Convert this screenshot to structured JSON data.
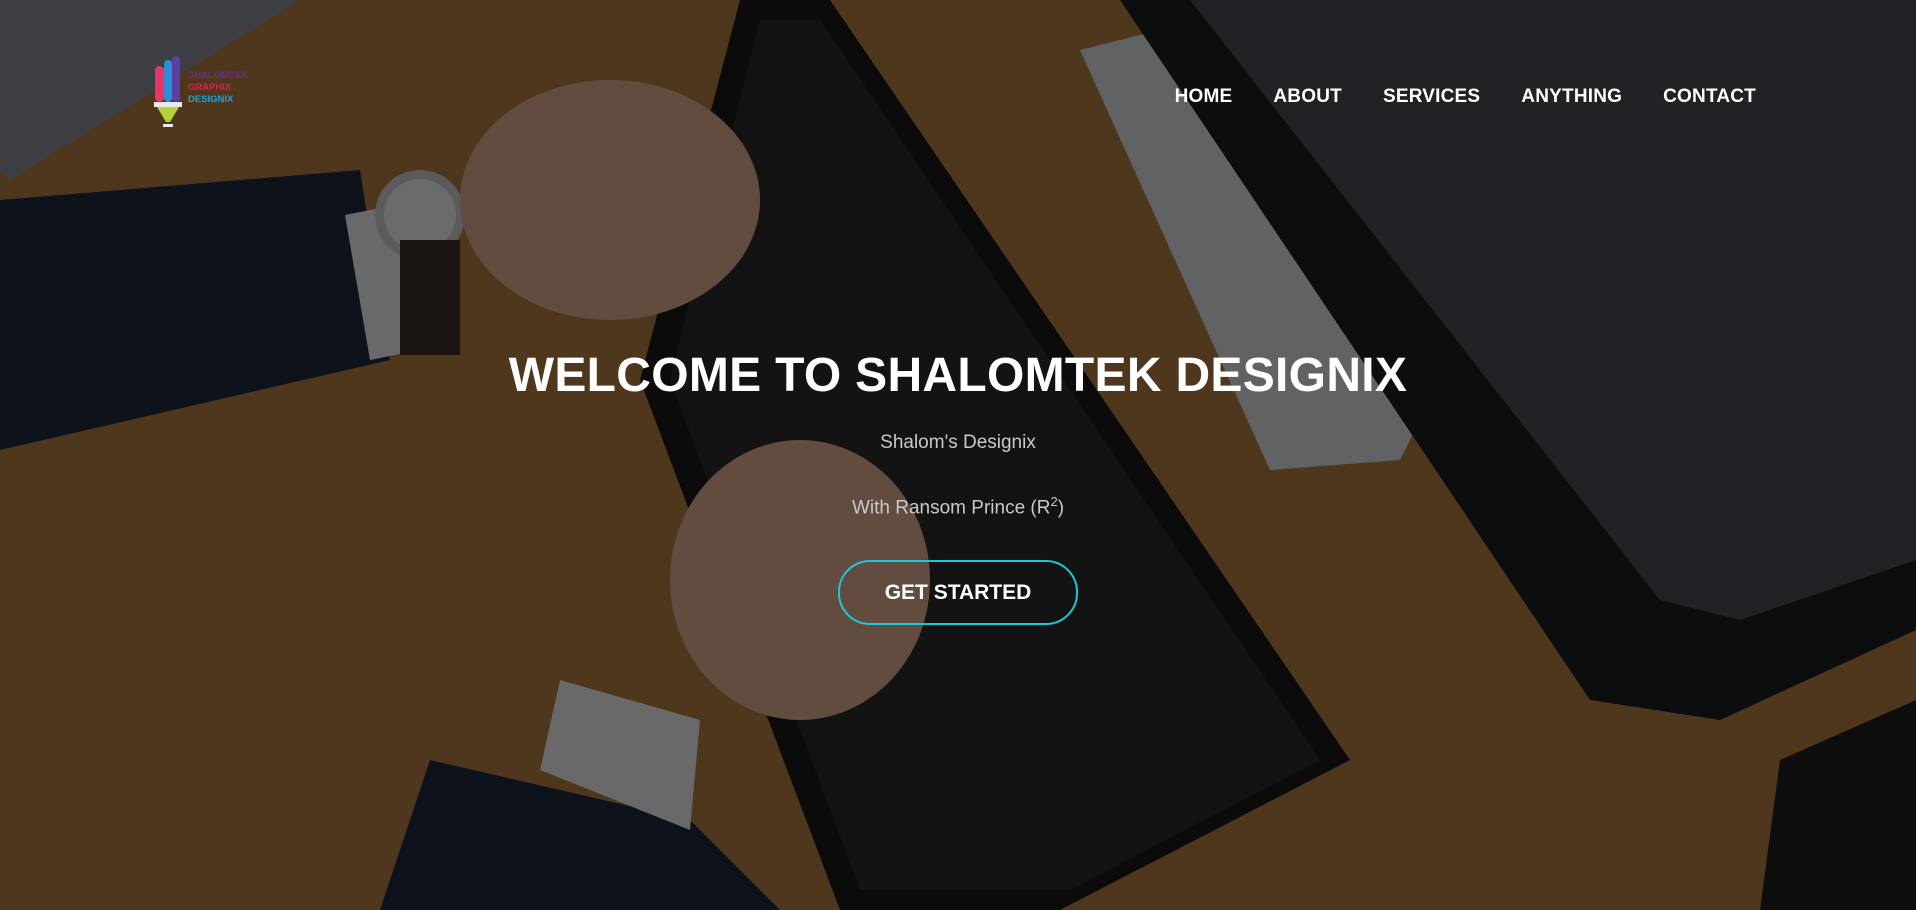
{
  "brand": {
    "logo_lines": [
      "SHALOMTEX",
      "GRAPHIX",
      "DESIGNIX"
    ],
    "colors": {
      "line1": "#6b2f7e",
      "line2": "#d6224f",
      "line3": "#1ea3d6",
      "pencil_pink": "#e8336b",
      "pencil_purple": "#5b3fa6",
      "pencil_blue": "#2d8fd6",
      "pencil_tip": "#b4d23b"
    }
  },
  "nav": {
    "items": [
      "HOME",
      "ABOUT",
      "SERVICES",
      "ANYTHING",
      "CONTACT"
    ]
  },
  "hero": {
    "title": "WELCOME TO SHALOMTEK DESIGNIX",
    "subtitle": "Shalom's Designix",
    "credit_prefix": "With Ransom Prince (R",
    "credit_sup": "2",
    "credit_suffix": ")",
    "cta_label": "GET STARTED",
    "accent_color": "#1ec8d6",
    "background": "photo of hands typing on a black keyboard at a wooden desk"
  }
}
